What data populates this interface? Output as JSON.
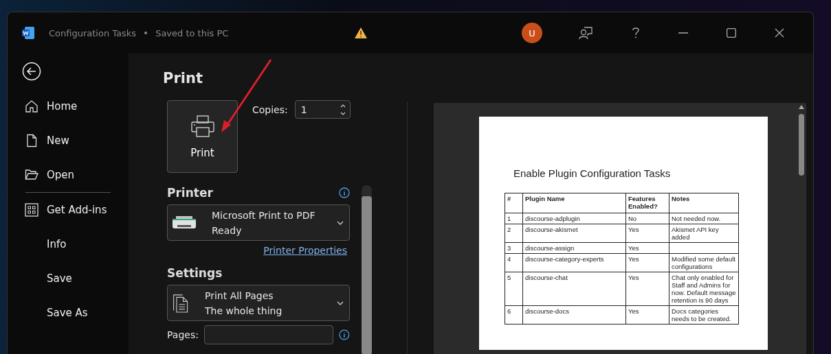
{
  "window": {
    "title": "Configuration Tasks",
    "save_status": "Saved to this PC",
    "avatar": "U"
  },
  "sidebar": {
    "top_items": [
      {
        "label": "Home"
      },
      {
        "label": "New"
      },
      {
        "label": "Open"
      }
    ],
    "bottom_items": [
      {
        "label": "Get Add-ins"
      },
      {
        "label": "Info"
      },
      {
        "label": "Save"
      },
      {
        "label": "Save As"
      }
    ]
  },
  "print_panel": {
    "title": "Print",
    "print_button": "Print",
    "copies": {
      "label": "Copies:",
      "value": "1"
    },
    "printer": {
      "heading": "Printer",
      "name": "Microsoft Print to PDF",
      "status": "Ready",
      "link": "Printer Properties"
    },
    "settings": {
      "heading": "Settings",
      "primary": "Print All Pages",
      "secondary": "The whole thing"
    },
    "pages": {
      "label": "Pages:"
    }
  },
  "preview": {
    "title": "Enable Plugin Configuration Tasks",
    "columns": [
      "#",
      "Plugin Name",
      "Features Enabled?",
      "Notes"
    ],
    "rows": [
      [
        "1",
        "discourse-adplugin",
        "No",
        "Not needed now."
      ],
      [
        "2",
        "discourse-akismet",
        "Yes",
        "Akismet API key added"
      ],
      [
        "3",
        "discourse-assign",
        "Yes",
        ""
      ],
      [
        "4",
        "discourse-category-experts",
        "Yes",
        "Modified some default configurations"
      ],
      [
        "5",
        "discourse-chat",
        "Yes",
        "Chat only enabled for Staff and Admins for now. Default message retention is 90 days"
      ],
      [
        "6",
        "discourse-docs",
        "Yes",
        "Docs categories needs to be created."
      ]
    ]
  }
}
